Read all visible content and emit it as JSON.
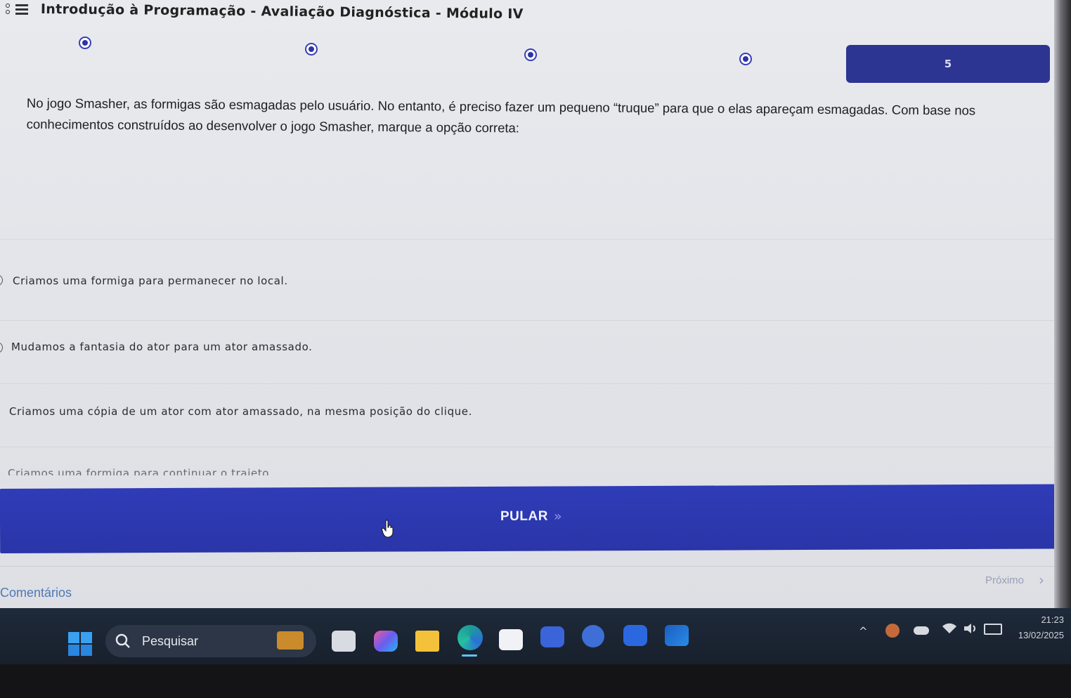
{
  "header": {
    "title": "Introdução à Programação - Avaliação Diagnóstica - Módulo IV"
  },
  "stepper": {
    "current_label": "5"
  },
  "question": {
    "text": "No jogo Smasher, as formigas são esmagadas pelo usuário. No entanto, é preciso fazer um pequeno “truque” para que o elas apareçam esmagadas. Com base nos conhecimentos construídos ao desenvolver o jogo Smasher, marque a opção correta:"
  },
  "options": [
    {
      "label": "Criamos uma formiga para permanecer no local."
    },
    {
      "label": "Mudamos a fantasia do ator para um ator amassado."
    },
    {
      "label": "Criamos uma cópia de um ator com ator amassado, na mesma posição do clique."
    },
    {
      "label": "Criamos uma formiga para continuar o trajeto"
    }
  ],
  "skip_button": {
    "label": "PULAR",
    "chevron": "»"
  },
  "footer": {
    "comments_label": "Comentários",
    "next_label": "Próximo",
    "next_chevron": "›"
  },
  "taskbar": {
    "search_placeholder": "Pesquisar",
    "time": "21:23",
    "date": "13/02/2025",
    "icons": [
      "windows-start-icon",
      "search-icon",
      "widgets-icon",
      "task-view-icon",
      "copilot-icon",
      "file-explorer-icon",
      "edge-icon",
      "microsoft-store-icon",
      "calculator-icon",
      "sync-icon",
      "zoom-icon",
      "outlook-icon"
    ]
  },
  "colors": {
    "accent": "#2d3592",
    "skip_button": "#2f3cb7",
    "comments_link": "#4f78b8",
    "page_bg": "#e6e7ec"
  }
}
